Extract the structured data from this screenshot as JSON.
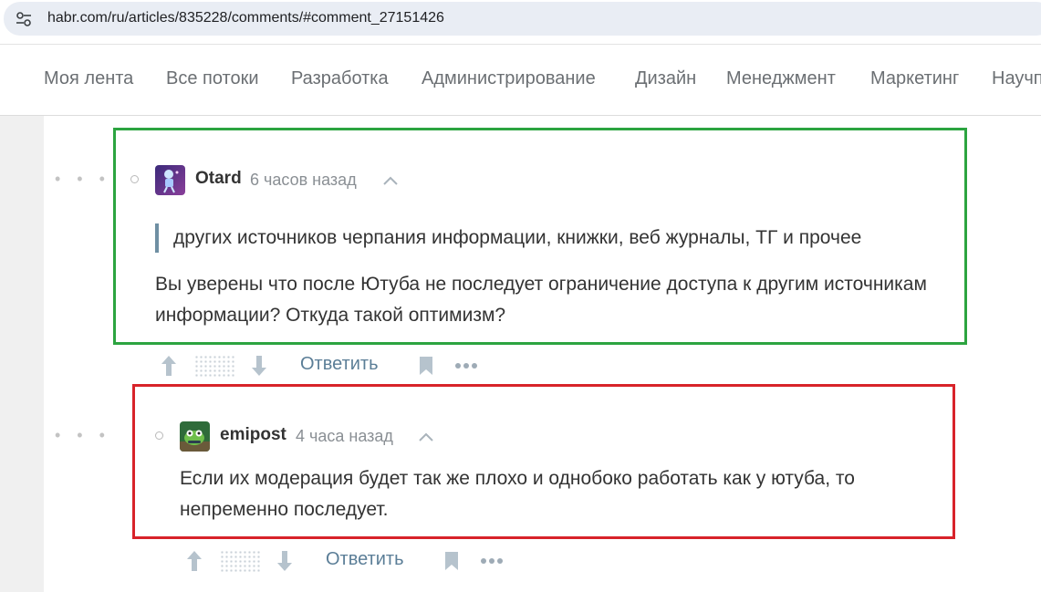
{
  "browser": {
    "url": "habr.com/ru/articles/835228/comments/#comment_27151426"
  },
  "nav": {
    "items": [
      "Моя лента",
      "Все потоки",
      "Разработка",
      "Администрирование",
      "Дизайн",
      "Менеджмент",
      "Маркетинг",
      "Научпоп"
    ]
  },
  "comments": [
    {
      "author": "Otard",
      "time": "6 часов назад",
      "quote": "других источников черпания информации, книжки, веб журналы, ТГ и прочее",
      "body": "Вы уверены что после Ютуба не последует ограничение доступа к другим источникам информации? Откуда такой оптимизм?",
      "reply_label": "Ответить"
    },
    {
      "author": "emipost",
      "time": "4 часа назад",
      "body": "Если их модерация будет так же плохо и однобоко работать как у ютуба, то непременно последует.",
      "reply_label": "Ответить"
    }
  ],
  "colors": {
    "highlight_green": "#2ca440",
    "highlight_red": "#d8232a",
    "link": "#5b7e97",
    "quote_bar": "#6f8fa3"
  }
}
